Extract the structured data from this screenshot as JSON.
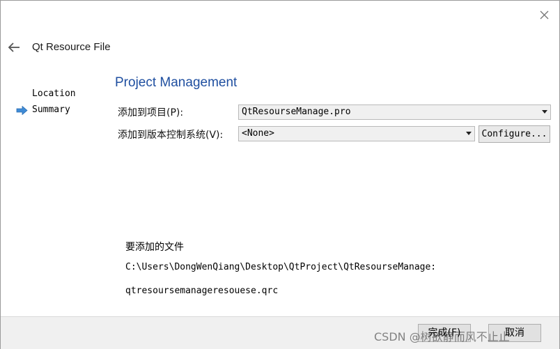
{
  "window": {
    "title": "Qt Resource File",
    "close_icon": "close-icon",
    "back_icon": "back-arrow-icon"
  },
  "steps": [
    {
      "label": "Location",
      "current": false
    },
    {
      "label": "Summary",
      "current": true
    }
  ],
  "page": {
    "title": "Project Management",
    "project_label": "添加到项目(P):",
    "project_value": "QtResourseManage.pro",
    "vcs_label": "添加到版本控制系统(V):",
    "vcs_value": "<None>",
    "configure_button": "Configure..."
  },
  "files": {
    "title": "要添加的文件",
    "path": "C:\\Users\\DongWenQiang\\Desktop\\QtProject\\QtResourseManage:",
    "file": "qtresoursemanageresouese.qrc"
  },
  "footer": {
    "finish_button": "完成(F)",
    "cancel_button": "取消",
    "watermark": "CSDN @树欲静而风不止止"
  },
  "colors": {
    "title_blue": "#1f4fa0",
    "step_arrow": "#3f8bd6"
  }
}
